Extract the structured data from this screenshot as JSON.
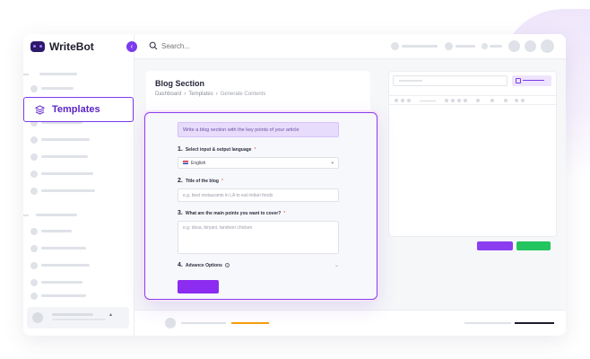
{
  "brand": {
    "name": "WriteBot",
    "collapse_glyph": "‹"
  },
  "search": {
    "placeholder": "Search..."
  },
  "sidebar": {
    "active_item": {
      "label": "Templates",
      "icon": "layers-icon"
    }
  },
  "page": {
    "title": "Blog Section",
    "breadcrumb": [
      "Dashboard",
      "Templates",
      "Generate Contents"
    ],
    "breadcrumb_sep": "›"
  },
  "form": {
    "hint": "Write a blog section with the key points of your article",
    "q1": {
      "number": "1.",
      "label": "Select input & output language",
      "value": "English"
    },
    "q2": {
      "number": "2.",
      "label": "Title of the blog",
      "placeholder": "e.g. best restaurants in LA to eat indian foods"
    },
    "q3": {
      "number": "3.",
      "label": "What are the main points you want to cover?",
      "placeholder": "e.g. dosa, biryani, tandoori chicken"
    },
    "q4": {
      "number": "4.",
      "label": "Advance Options"
    },
    "required_mark": "*"
  },
  "colors": {
    "accent": "#7c3aed",
    "green": "#22c55e",
    "orange": "#f59e0b"
  }
}
